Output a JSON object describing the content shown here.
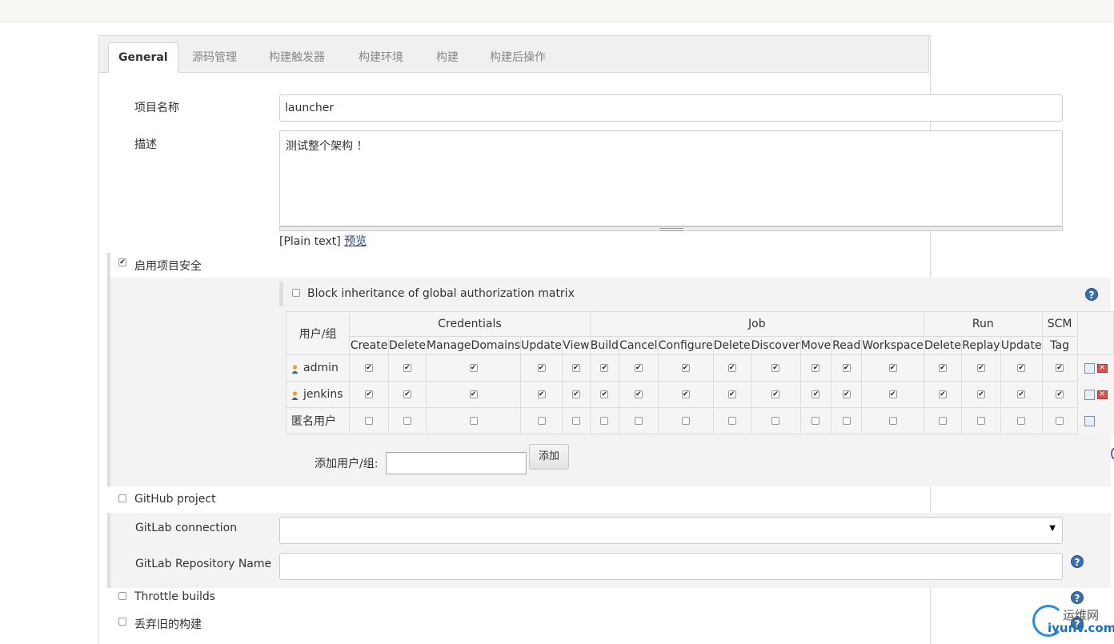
{
  "tabs": [
    "General",
    "源码管理",
    "构建触发器",
    "构建环境",
    "构建",
    "构建后操作"
  ],
  "project_name": {
    "label": "项目名称",
    "value": "launcher"
  },
  "description": {
    "label": "描述",
    "value": "测试整个架构 ！",
    "format": "[Plain text]",
    "preview": "预览"
  },
  "security": {
    "label": "启用项目安全",
    "checked": true,
    "block_label": "Block inheritance of global authorization matrix",
    "block_checked": false,
    "matrix": {
      "user_group_header": "用户/组",
      "groups": [
        {
          "name": "Credentials",
          "span": 5
        },
        {
          "name": "Job",
          "span": 8
        },
        {
          "name": "Run",
          "span": 3
        },
        {
          "name": "SCM",
          "span": 1
        }
      ],
      "permissions": [
        "Create",
        "Delete",
        "ManageDomains",
        "Update",
        "View",
        "Build",
        "Cancel",
        "Configure",
        "Delete",
        "Discover",
        "Move",
        "Read",
        "Workspace",
        "Delete",
        "Replay",
        "Update",
        "Tag"
      ],
      "rows": [
        {
          "name": "admin",
          "user": true,
          "checked": true,
          "deletable": true
        },
        {
          "name": "jenkins",
          "user": true,
          "checked": true,
          "deletable": true
        },
        {
          "name": "匿名用户",
          "user": false,
          "checked": false,
          "deletable": false
        }
      ]
    },
    "add_label": "添加用户/组:",
    "add_button": "添加"
  },
  "github_project": {
    "label": "GitHub project",
    "checked": false
  },
  "gitlab_connection": {
    "label": "GitLab connection",
    "value": ""
  },
  "gitlab_repo": {
    "label": "GitLab Repository Name",
    "value": ""
  },
  "throttle": {
    "label": "Throttle builds",
    "checked": false
  },
  "discard": {
    "label": "丢弃旧的构建",
    "checked": false
  },
  "watermark": {
    "line1": "运维网",
    "line2": "iyunv.com"
  }
}
